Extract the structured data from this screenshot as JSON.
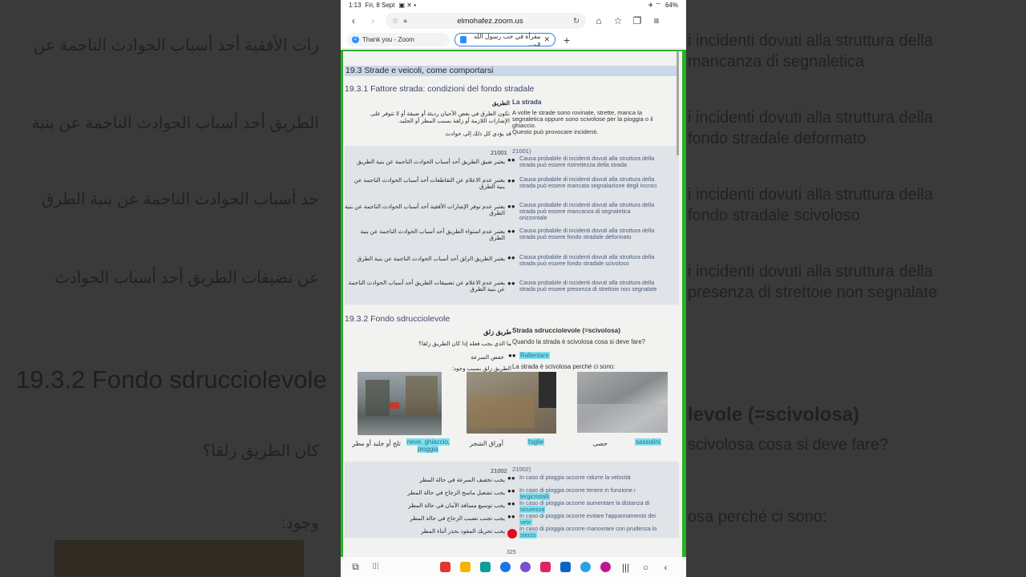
{
  "status_bar": {
    "time": "1:13",
    "date": "Fri, 8 Sept",
    "battery": "64%"
  },
  "browser": {
    "url": "elmohafez.zoom.us",
    "tabs": [
      {
        "label": "Thank you - Zoom",
        "active": false
      },
      {
        "label": "مقرأة في حب رسول الله ف...",
        "active": true
      }
    ]
  },
  "document": {
    "section_title": "19.3 Strade e veicoli, come comportarsi",
    "sub1_title": "19.3.1 Fattore strada: condizioni del fondo stradale",
    "intro": {
      "ar_head": "الطريق",
      "it_head": "La strada",
      "ar_text_1": "تكون الطرق في بعض الأحيان رديئة أو ضيقة أو لا تتوفر على",
      "ar_text_2": "الإشارات اللازمة أو زلقة بسبب المطر أو الجليد.",
      "ar_text_3": "قد يؤدي كل ذلك إلى حوادث",
      "it_text_1": "A volte le strade sono rovinate, strette, manca la",
      "it_text_2": "segnaletica oppure sono scivolose per la pioggia o il",
      "it_text_3": "ghiaccio.",
      "it_text_4": "Questo può provocare incidenti."
    },
    "code1_ar": "21001",
    "code1_it": "21001)",
    "rows1": [
      {
        "ar": "يعتبر ضيق الطريق أحد أسباب الحوادث الناجمة عن بنية الطريق",
        "it1": "Causa probabile di incidenti dovuti alla struttura della",
        "it2": "strada può essere ristrettezza della strada"
      },
      {
        "ar": "يعتبر عدم الاعلام عن التقاطعات أحد أسباب الحوادث الناجمة عن بنية الطرق",
        "it1": "Causa probabile di incidenti dovuti alla struttura della",
        "it2": "strada può essere mancata segnalazione degli incroci"
      },
      {
        "ar": "يعتبر عدم توفر الإشارات الأفقية أحد أسباب الحوادث الناجمة عن بنية الطرق",
        "it1": "Causa probabile di incidenti dovuti alla struttura della",
        "it2": "strada può essere mancanza di segnaletica",
        "it3": "orizzontale"
      },
      {
        "ar": "يعتبر عدم استواء الطريق أحد أسباب الحوادث الناجمة عن بنية الطرق",
        "it1": "Causa probabile di incidenti dovuti alla struttura della",
        "it2": "strada può essere fondo stradale deformato"
      },
      {
        "ar": "يعتبر الطريق الزلق أحد أسباب الحوادث الناجمة عن بنية الطرق",
        "it1": "Causa probabile di incidenti dovuti alla struttura della",
        "it2": "strada può essere fondo stradale scivoloso"
      },
      {
        "ar": "يعتبر عدم الاعلام عن تضييقات الطريق أحد أسباب الحوادث الناجمة عن بنية الطرق",
        "it1": "Causa probabile di incidenti dovuti alla struttura della",
        "it2": "strada può essere presenza di strettoie non segnalate"
      }
    ],
    "sub2_title": "19.3.2 Fondo sdrucciolevole",
    "slippery": {
      "ar_head": "طريق زلق",
      "it_head": "Strada sdrucciolevole (=scivolosa)",
      "ar_q": "ما الذي يجب فعله إذا كان الطريق زلقا؟",
      "it_q": "Quando la strada è scivolosa cosa si deve fare?",
      "ar_a": "خفض السرعة",
      "it_a": "Rallentare",
      "ar_causes": "الطريق زلق بسبب وجود:",
      "it_causes": "La strada è scivolosa perché ci sono:"
    },
    "captions": [
      {
        "ar": "ثلج أو جليد أو مطر",
        "it": "neve, ghiaccio, pioggia"
      },
      {
        "ar": "أوراق الشجر",
        "it": "foglie"
      },
      {
        "ar": "حصى",
        "it": "sassolini"
      }
    ],
    "code2_ar": "21002",
    "code2_it": "21002)",
    "rows2": [
      {
        "ar": "يجب تخفيف السرعة في حالة المطر",
        "it": "In caso di pioggia occorre ridurre la velocità"
      },
      {
        "ar": "يجب تشغيل ماسح الزجاج في حالة المطر",
        "it": "In caso di pioggia occorre tenere in funzione i",
        "it2": "tergicristalli"
      },
      {
        "ar": "يجب توسيع مسافة الأمان في حالة المطر",
        "it": "In caso di pioggia occorre aumentare la distanza di",
        "it2": "sicurezza"
      },
      {
        "ar": "يجب تجنب تضبب الزجاج في حالة المطر",
        "it": "In caso di pioggia occorre evitare l'appannamento dei",
        "it2": "vetri"
      },
      {
        "ar": "يجب تحريك المقود بحذر أثناء المطر",
        "it": "In caso di pioggia occorre manovrare con prudenza lo",
        "it2": "sterzo"
      }
    ],
    "page_number": "325"
  },
  "background_mirror": {
    "left_lines": [
      "رات الأفقية أحد أسباب الحوادث الناجمة عن",
      "الطريق أحد أسباب الحوادث الناجمة عن بنية",
      "حد أسباب الحوادث الناجمة عن بنية الطرق",
      "عن تضيقات الطريق أحد أسباب الحوادث",
      "19.3.2 Fondo sdrucciolevole",
      "كان الطريق زلقا؟",
      "وجود:"
    ],
    "right_lines": [
      "i incidenti dovuti alla struttura della",
      "mancanza di segnaletica",
      "i incidenti dovuti alla struttura della",
      "fondo stradale deformato",
      "i incidenti dovuti alla struttura della",
      "fondo stradale scivoloso",
      "i incidenti dovuti alla struttura della",
      "presenza di strettoie non segnalate",
      "levole (=scivolosa)",
      "scivolosa cosa si deve fare?",
      "osa perché ci sono:"
    ]
  }
}
